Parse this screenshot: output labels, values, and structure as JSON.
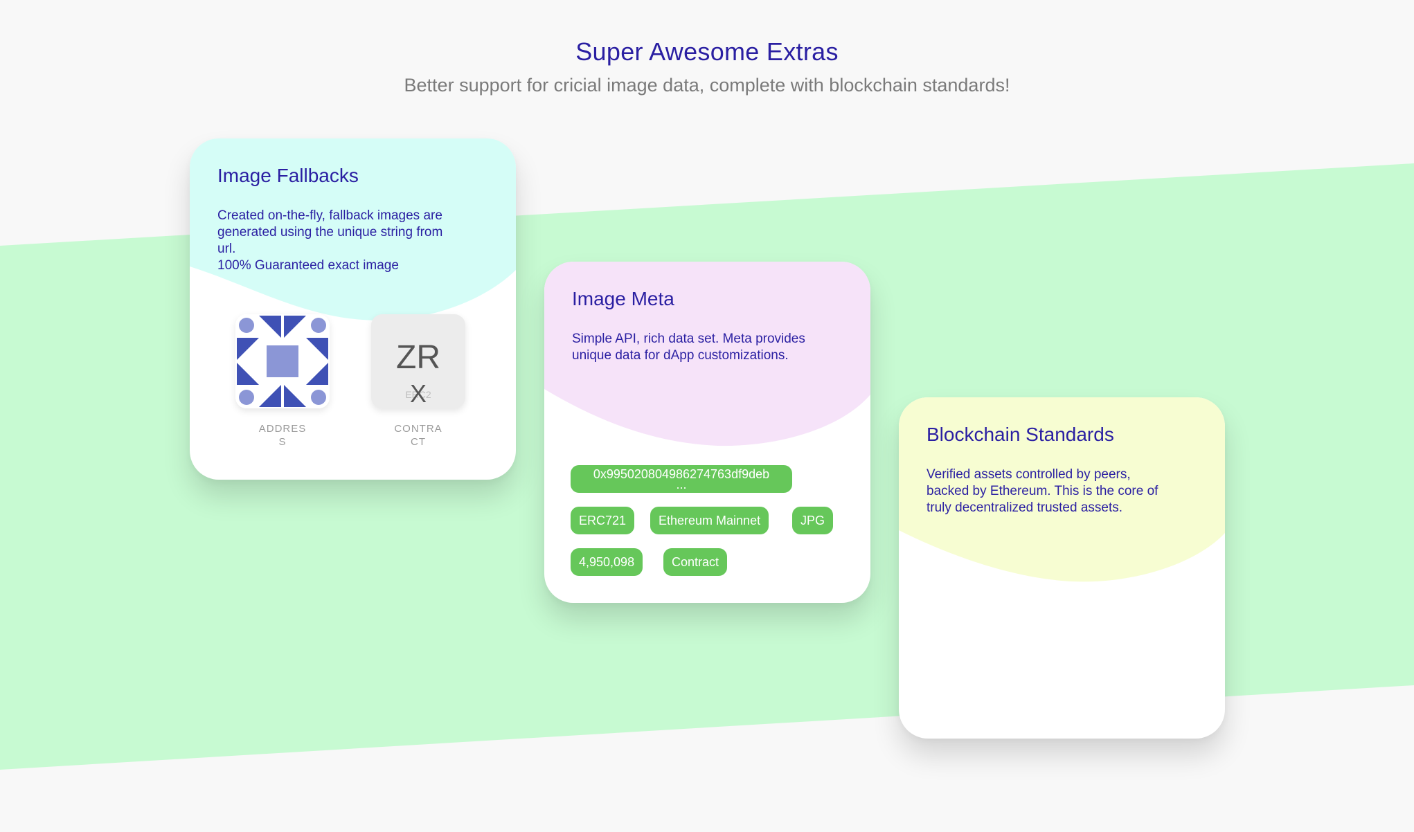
{
  "section": {
    "title": "Super Awesome Extras",
    "subtitle": "Better support for cricial image data, complete with blockchain standards!"
  },
  "colors": {
    "background": "#f8f8f8",
    "band": "#c7fad2",
    "title": "#2a1fa2",
    "card1_blob": "#d5fdf7",
    "card2_blob": "#f6e3f9",
    "card3_blob": "#f7fdd2",
    "tag": "#66c75a"
  },
  "cards": [
    {
      "title": "Image Fallbacks",
      "desc": [
        "Created on-the-fly, fallback images are",
        "generated using the unique string from",
        "url.",
        "100% Guaranteed exact image"
      ],
      "thumbs": {
        "address": {
          "label": "ADDRESS",
          "icon": "identicon"
        },
        "contract": {
          "label": "CONTRACT",
          "symbol_top": "ZR",
          "symbol_bottom": "X",
          "standard": "ERC2"
        }
      }
    },
    {
      "title": "Image Meta",
      "desc": [
        "Simple API, rich data set. Meta provides",
        "unique data for dApp customizations."
      ],
      "tags": {
        "hash_line1": "0x995020804986274763df9deb",
        "hash_line2": "...",
        "erc": "ERC721",
        "network": "Ethereum Mainnet",
        "format": "JPG",
        "count": "4,950,098",
        "type": "Contract"
      }
    },
    {
      "title": "Blockchain Standards",
      "desc": [
        "Verified assets controlled by peers,",
        "backed by Ethereum. This is the core of",
        "truly decentralized trusted assets."
      ]
    }
  ]
}
